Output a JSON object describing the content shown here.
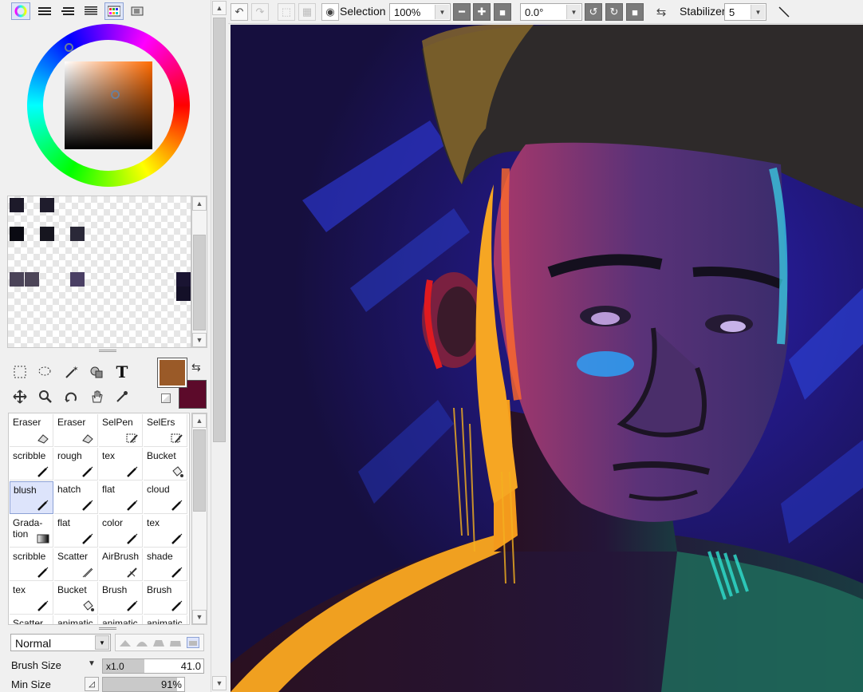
{
  "panel_tabs": [
    {
      "name": "color-wheel-tab-icon",
      "active": true
    },
    {
      "name": "rgb-sliders-tab-icon",
      "active": false
    },
    {
      "name": "hsv-sliders-tab-icon",
      "active": false
    },
    {
      "name": "color-mixer-tab-icon",
      "active": false
    },
    {
      "name": "swatches-tab-icon",
      "active": true
    },
    {
      "name": "scratchpad-tab-icon",
      "active": false
    }
  ],
  "color": {
    "primary": "#9a5a28",
    "secondary": "#5c0a2a"
  },
  "swatches": {
    "colors": [
      "#1d1a2a",
      "#1f1c2c",
      "#0a0a12",
      "#16151f",
      "#2a2838",
      "#4a4358",
      "#4c4558",
      "#4a3f64",
      "#1a1432",
      "#141028"
    ]
  },
  "toolbar": {
    "selection_label": "Selection",
    "zoom_value": "100%",
    "rotation_value": "0.0°",
    "stabilizer_label": "Stabilizer",
    "stabilizer_value": "5"
  },
  "brushes": {
    "rows": [
      [
        {
          "label": "Eraser",
          "icon": "eraser-icon"
        },
        {
          "label": "Eraser",
          "icon": "eraser-icon"
        },
        {
          "label": "SelPen",
          "icon": "selpen-icon"
        },
        {
          "label": "SelErs",
          "icon": "selers-icon"
        }
      ],
      [
        {
          "label": "scribble",
          "icon": "pen-icon"
        },
        {
          "label": "rough",
          "icon": "pen-icon"
        },
        {
          "label": "tex",
          "icon": "pen-icon"
        },
        {
          "label": "Bucket",
          "icon": "bucket-icon"
        }
      ],
      [
        {
          "label": "blush",
          "icon": "pen-icon",
          "selected": true
        },
        {
          "label": "hatch",
          "icon": "pen-icon"
        },
        {
          "label": "flat",
          "icon": "pen-icon"
        },
        {
          "label": "cloud",
          "icon": "pen-icon"
        }
      ],
      [
        {
          "label": "Grada-\ntion",
          "icon": "gradation-icon"
        },
        {
          "label": "flat",
          "icon": "pen-icon"
        },
        {
          "label": "color",
          "icon": "pen-icon"
        },
        {
          "label": "tex",
          "icon": "pen-icon"
        }
      ],
      [
        {
          "label": "scribble",
          "icon": "pen-icon"
        },
        {
          "label": "Scatter",
          "icon": "pencil-icon"
        },
        {
          "label": "AirBrush",
          "icon": "airbrush-icon"
        },
        {
          "label": "shade",
          "icon": "pen-icon"
        }
      ],
      [
        {
          "label": "tex",
          "icon": "pen-icon"
        },
        {
          "label": "Bucket",
          "icon": "bucket-icon"
        },
        {
          "label": "Brush",
          "icon": "pen-icon"
        },
        {
          "label": "Brush",
          "icon": "pen-icon"
        }
      ],
      [
        {
          "label": "Scatter",
          "icon": "pen-icon"
        },
        {
          "label": "animatic",
          "icon": "pen-icon"
        },
        {
          "label": "animatic",
          "icon": "pen-icon"
        },
        {
          "label": "animatic",
          "icon": "pen-icon"
        }
      ]
    ]
  },
  "blend": {
    "mode": "Normal"
  },
  "brush_size": {
    "label": "Brush Size",
    "multiplier": "x1.0",
    "value": "41.0",
    "fill_fraction": 0.41
  },
  "min_size": {
    "label": "Min Size",
    "value": "91%",
    "fill_fraction": 0.91
  }
}
